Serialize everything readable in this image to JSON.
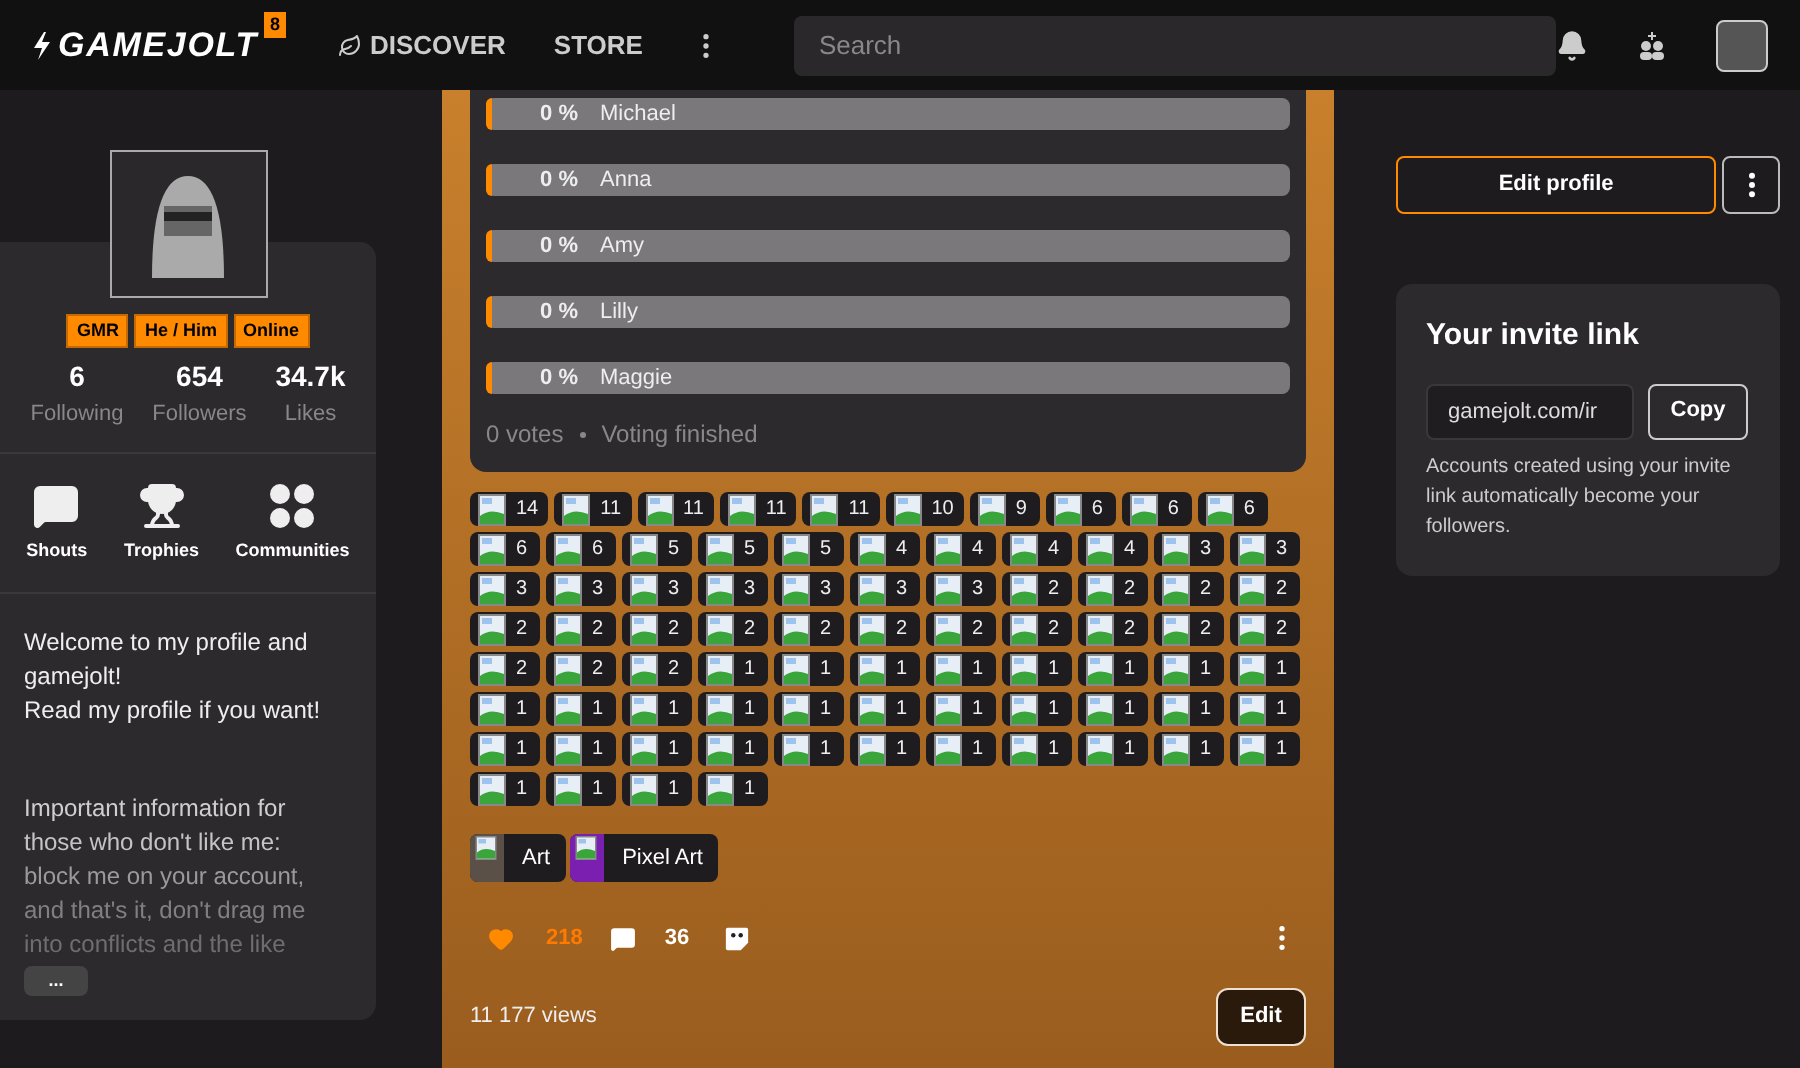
{
  "header": {
    "logo": "GAMEJOLT",
    "logo_badge": "8",
    "nav": [
      {
        "label": "DISCOVER",
        "kind": "discover"
      },
      {
        "label": "STORE",
        "kind": "store"
      }
    ],
    "search": {
      "placeholder": "Search"
    }
  },
  "profile": {
    "tags": [
      "GMR",
      "He / Him",
      "Online"
    ],
    "stats": [
      {
        "value": "6",
        "label": "Following"
      },
      {
        "value": "654",
        "label": "Followers"
      },
      {
        "value": "34.7k",
        "label": "Likes"
      }
    ],
    "links": [
      {
        "label": "Shouts",
        "kind": "shouts"
      },
      {
        "label": "Trophies",
        "kind": "trophies"
      },
      {
        "label": "Communities",
        "kind": "communities"
      }
    ],
    "bio": [
      "Welcome to my profile and gamejolt!",
      "Read my profile if you want!"
    ],
    "bio_faded": [
      "Important information for",
      "those who don't like me:",
      "block me on your account,",
      "and that's it, don't drag me",
      "into conflicts and the like"
    ],
    "more_button": "..."
  },
  "poll": {
    "options": [
      {
        "percent": "0 %",
        "name": "Michael",
        "level": 0
      },
      {
        "percent": "0 %",
        "name": "Anna",
        "level": 0
      },
      {
        "percent": "0 %",
        "name": "Amy",
        "level": 0
      },
      {
        "percent": "0 %",
        "name": "Lilly",
        "level": 0
      },
      {
        "percent": "0 %",
        "name": "Maggie",
        "level": 0
      }
    ],
    "votes": "0 votes",
    "status": "Voting finished"
  },
  "reaction_rows": [
    [
      "14",
      "11",
      "11",
      "11",
      "11",
      "10",
      "9",
      "6",
      "6",
      "6"
    ],
    [
      "6",
      "6",
      "5",
      "5",
      "5",
      "4",
      "4",
      "4",
      "4",
      "3",
      "3"
    ],
    [
      "3",
      "3",
      "3",
      "3",
      "3",
      "3",
      "3",
      "2",
      "2",
      "2",
      "2"
    ],
    [
      "2",
      "2",
      "2",
      "2",
      "2",
      "2",
      "2",
      "2",
      "2",
      "2",
      "2"
    ],
    [
      "2",
      "2",
      "2",
      "1",
      "1",
      "1",
      "1",
      "1",
      "1",
      "1",
      "1"
    ],
    [
      "1",
      "1",
      "1",
      "1",
      "1",
      "1",
      "1",
      "1",
      "1",
      "1",
      "1"
    ],
    [
      "1",
      "1",
      "1",
      "1",
      "1",
      "1",
      "1",
      "1",
      "1",
      "1",
      "1"
    ],
    [
      "1",
      "1",
      "1",
      "1"
    ]
  ],
  "communities": [
    {
      "name": "Art",
      "color": "#5a5047"
    },
    {
      "name": "Pixel Art",
      "color": "#7a1fb0"
    }
  ],
  "post_actions": {
    "likes": "218",
    "liked": true,
    "comments": "36"
  },
  "views": "11 177 views",
  "edit_button": "Edit",
  "sidebar": {
    "edit_profile": "Edit profile",
    "invite": {
      "title": "Your invite link",
      "link": "gamejolt.com/ir",
      "copy": "Copy",
      "note": "Accounts created using your invite link automatically become your followers."
    }
  }
}
